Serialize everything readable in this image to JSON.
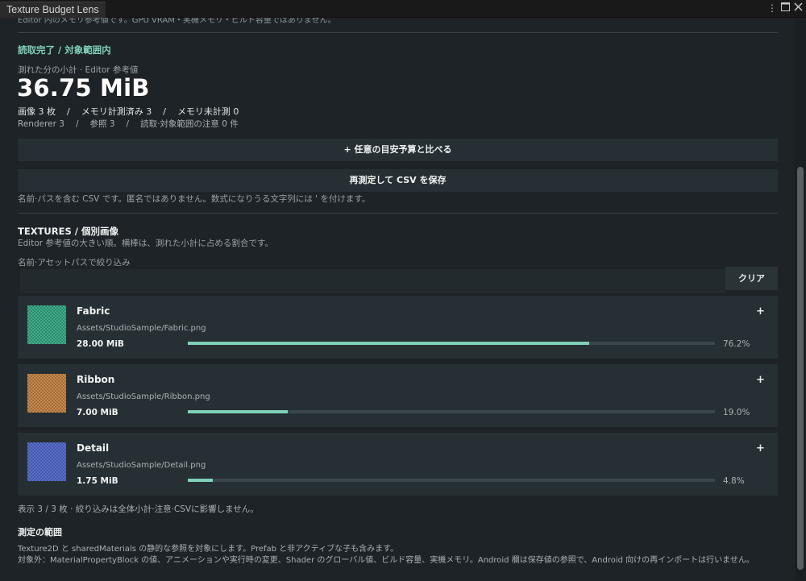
{
  "window": {
    "tab_title": "Texture Budget Lens"
  },
  "top_note": "Editor 内のメモリ参考値です。GPU VRAM・実機メモリ・ビルド容量ではありません。",
  "summary": {
    "status": "読取完了 / 対象範囲内",
    "subtotal_label": "測れた分の小計 · Editor 参考値",
    "total": "36.75 MiB",
    "images": "画像 3 枚",
    "measured": "メモリ計測済み 3",
    "unmeasured": "メモリ未計測 0",
    "renderers": "Renderer 3",
    "references": "参照 3",
    "warnings": "読取·対象範囲の注意 0 件"
  },
  "buttons": {
    "compare_budget": "+ 任意の目安予算と比べる",
    "remeasure_csv": "再測定して CSV を保存",
    "csv_note": "名前·パスを含む CSV です。匿名ではありません。数式になりうる文字列には ' を付けます。"
  },
  "textures": {
    "title": "TEXTURES / 個別画像",
    "subtitle": "Editor 参考値の大きい順。横棒は、測れた小計に占める割合です。",
    "filter_label": "名前·アセットパスで絞り込み",
    "filter_value": "",
    "clear_label": "クリア",
    "items": [
      {
        "name": "Fabric",
        "path": "Assets/StudioSample/Fabric.png",
        "size": "28.00 MiB",
        "percent_label": "76.2%",
        "fraction": 0.762,
        "swatch": "#3fae8a",
        "plus": "+"
      },
      {
        "name": "Ribbon",
        "path": "Assets/StudioSample/Ribbon.png",
        "size": "7.00 MiB",
        "percent_label": "19.0%",
        "fraction": 0.19,
        "swatch": "#c98a4c",
        "plus": "+"
      },
      {
        "name": "Detail",
        "path": "Assets/StudioSample/Detail.png",
        "size": "1.75 MiB",
        "percent_label": "4.8%",
        "fraction": 0.048,
        "swatch": "#5a6fd0",
        "plus": "+"
      }
    ],
    "footer": "表示 3 / 3 枚 · 絞り込みは全体小計·注意·CSVに影響しません。"
  },
  "scope": {
    "title": "測定の範囲",
    "line1": "Texture2D と sharedMaterials の静的な参照を対象にします。Prefab と非アクティブな子も含みます。",
    "line2": "対象外：MaterialPropertyBlock の値、アニメーションや実行時の変更、Shader のグローバル値、ビルド容量、実機メモリ。Android 欄は保存値の参照で、Android 向けの再インポートは行いません。"
  },
  "colors": {
    "accent": "#7fd1b9",
    "panel": "#263034",
    "background": "#1d2326"
  }
}
